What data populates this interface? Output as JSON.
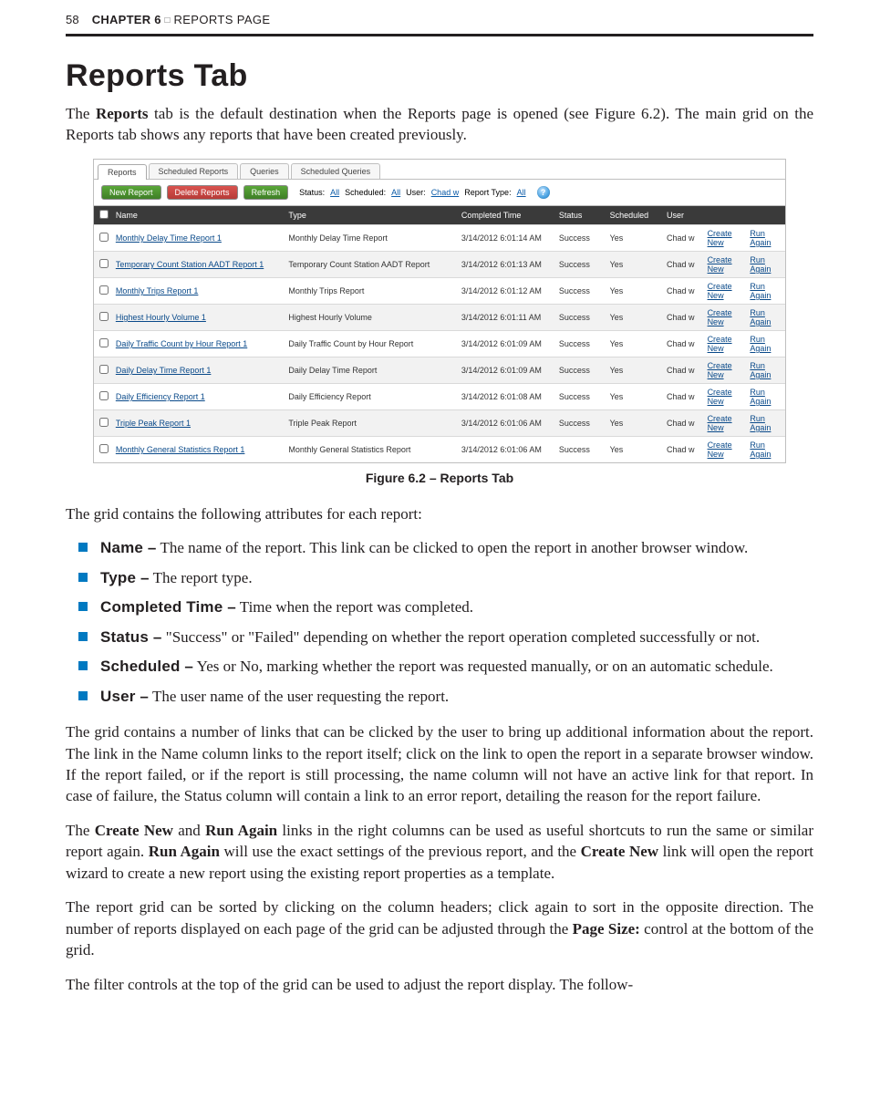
{
  "header": {
    "page_number": "58",
    "chapter": "CHAPTER 6",
    "square": "□",
    "chapter_title": "REPORTS PAGE"
  },
  "h1": "Reports Tab",
  "intro_pre": "The ",
  "intro_bold": "Reports",
  "intro_post": " tab is the default destination when the Reports page is opened (see Figure 6.2). The main grid on the Reports tab shows any reports that have been created previously.",
  "figure": {
    "caption": "Figure 6.2 – Reports Tab",
    "tabs": [
      "Reports",
      "Scheduled Reports",
      "Queries",
      "Scheduled Queries"
    ],
    "toolbar": {
      "new_report": "New Report",
      "delete_reports": "Delete Reports",
      "refresh": "Refresh"
    },
    "filters": {
      "status_label": "Status:",
      "status_value": "All",
      "scheduled_label": "Scheduled:",
      "scheduled_value": "All",
      "user_label": "User:",
      "user_value": "Chad w",
      "type_label": "Report Type:",
      "type_value": "All"
    },
    "help": "?",
    "columns": [
      "",
      "Name",
      "Type",
      "Completed Time",
      "Status",
      "Scheduled",
      "User",
      "",
      ""
    ],
    "rows": [
      {
        "name": "Monthly Delay Time Report 1",
        "type": "Monthly Delay Time Report",
        "completed": "3/14/2012 6:01:14 AM",
        "status": "Success",
        "scheduled": "Yes",
        "user": "Chad w",
        "create": "Create New",
        "run": "Run Again"
      },
      {
        "name": "Temporary Count Station AADT Report 1",
        "type": "Temporary Count Station AADT Report",
        "completed": "3/14/2012 6:01:13 AM",
        "status": "Success",
        "scheduled": "Yes",
        "user": "Chad w",
        "create": "Create New",
        "run": "Run Again"
      },
      {
        "name": "Monthly Trips Report 1",
        "type": "Monthly Trips Report",
        "completed": "3/14/2012 6:01:12 AM",
        "status": "Success",
        "scheduled": "Yes",
        "user": "Chad w",
        "create": "Create New",
        "run": "Run Again"
      },
      {
        "name": "Highest Hourly Volume 1",
        "type": "Highest Hourly Volume",
        "completed": "3/14/2012 6:01:11 AM",
        "status": "Success",
        "scheduled": "Yes",
        "user": "Chad w",
        "create": "Create New",
        "run": "Run Again"
      },
      {
        "name": "Daily Traffic Count by Hour Report 1",
        "type": "Daily Traffic Count by Hour Report",
        "completed": "3/14/2012 6:01:09 AM",
        "status": "Success",
        "scheduled": "Yes",
        "user": "Chad w",
        "create": "Create New",
        "run": "Run Again"
      },
      {
        "name": "Daily Delay Time Report 1",
        "type": "Daily Delay Time Report",
        "completed": "3/14/2012 6:01:09 AM",
        "status": "Success",
        "scheduled": "Yes",
        "user": "Chad w",
        "create": "Create New",
        "run": "Run Again"
      },
      {
        "name": "Daily Efficiency Report 1",
        "type": "Daily Efficiency Report",
        "completed": "3/14/2012 6:01:08 AM",
        "status": "Success",
        "scheduled": "Yes",
        "user": "Chad w",
        "create": "Create New",
        "run": "Run Again"
      },
      {
        "name": "Triple Peak Report 1",
        "type": "Triple Peak Report",
        "completed": "3/14/2012 6:01:06 AM",
        "status": "Success",
        "scheduled": "Yes",
        "user": "Chad w",
        "create": "Create New",
        "run": "Run Again"
      },
      {
        "name": "Monthly General Statistics Report 1",
        "type": "Monthly General Statistics Report",
        "completed": "3/14/2012 6:01:06 AM",
        "status": "Success",
        "scheduled": "Yes",
        "user": "Chad w",
        "create": "Create New",
        "run": "Run Again"
      }
    ]
  },
  "attr_intro": "The grid contains the following attributes for each report:",
  "bullets": [
    {
      "term": "Name –",
      "text": " The name of the report. This link can be clicked to open the report in another browser window."
    },
    {
      "term": "Type –",
      "text": " The report type."
    },
    {
      "term": "Completed Time –",
      "text": " Time when the report was completed."
    },
    {
      "term": "Status –",
      "text": " \"Success\" or \"Failed\" depending on whether the report operation completed successfully or not."
    },
    {
      "term": "Scheduled –",
      "text": " Yes or No, marking whether the report was requested manually, or on an automatic schedule."
    },
    {
      "term": "User –",
      "text": " The user name of the user requesting the report."
    }
  ],
  "para_links": "The grid contains a number of links that can be clicked by the user to bring up additional information about the report. The link in the Name column links to the report itself; click on the link to open the report in a separate browser window. If the report failed, or if the report is still processing, the name column will not have an active link for that report. In case of failure, the Status column will contain a link to an error report, detailing the reason for the report failure.",
  "para_shortcuts": {
    "pre": "The ",
    "b1": "Create New",
    "mid1": " and ",
    "b2": "Run Again",
    "mid2": " links in the right columns can be used as useful shortcuts to run the same or similar report again. ",
    "b3": "Run Again",
    "mid3": " will use the exact settings of the previous report,  and the ",
    "b4": "Create New",
    "post": " link will open the report wizard to create a new report using the existing report properties as a template."
  },
  "para_sort": {
    "pre": "The report grid can be sorted by clicking on the column headers; click again to sort in the opposite direction. The number of reports displayed on each page of the grid can be adjusted through the ",
    "b": "Page Size:",
    "post": " control at the bottom of the grid."
  },
  "para_filter": "The filter controls at the top of the grid can be used to adjust the report display. The follow-"
}
